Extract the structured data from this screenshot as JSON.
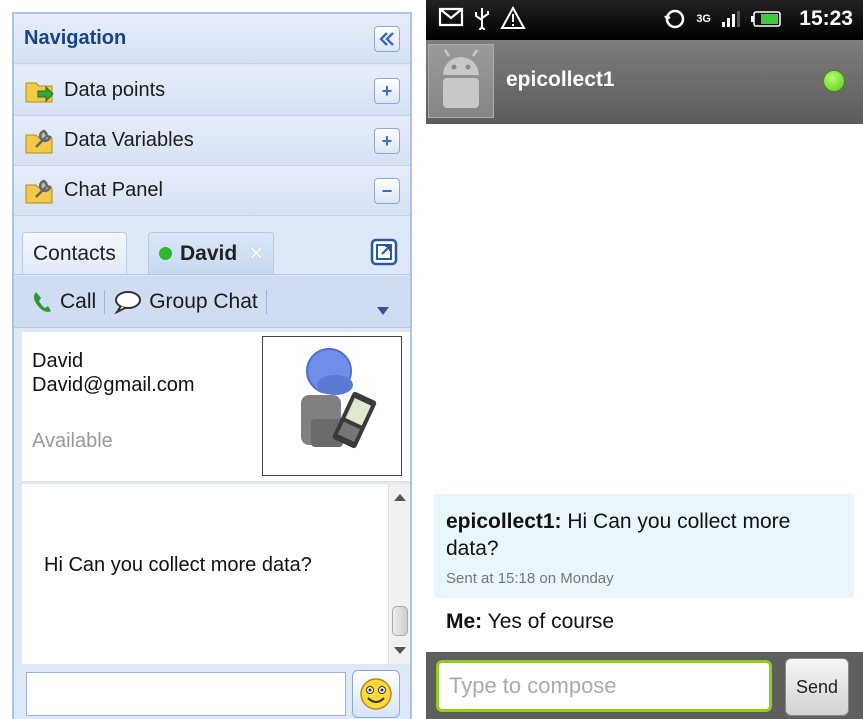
{
  "nav": {
    "title": "Navigation",
    "items": [
      {
        "label": "Data points",
        "toggle": "+"
      },
      {
        "label": "Data Variables",
        "toggle": "+"
      },
      {
        "label": "Chat Panel",
        "toggle": "−"
      }
    ]
  },
  "chat": {
    "tabs": {
      "contacts": "Contacts",
      "active": "David",
      "close": "×"
    },
    "toolbar": {
      "call": "Call",
      "group_chat": "Group Chat"
    },
    "contact": {
      "name": "David",
      "email": "David@gmail.com",
      "status": "Available"
    },
    "message": "Hi Can you collect more data?",
    "input_value": ""
  },
  "android": {
    "status_time": "15:23",
    "network_label": "3G",
    "contact_name": "epicollect1",
    "incoming": {
      "sender": "epicollect1:",
      "text": "Hi Can you collect more data?",
      "meta": "Sent at 15:18 on Monday"
    },
    "outgoing": {
      "sender": "Me:",
      "text": "Yes of course"
    },
    "compose_placeholder": "Type to compose",
    "send_label": "Send"
  },
  "colors": {
    "nav_title": "#15428b",
    "online": "#2eb82e",
    "android_online": "#57c81a",
    "compose_border": "#98c91c"
  }
}
